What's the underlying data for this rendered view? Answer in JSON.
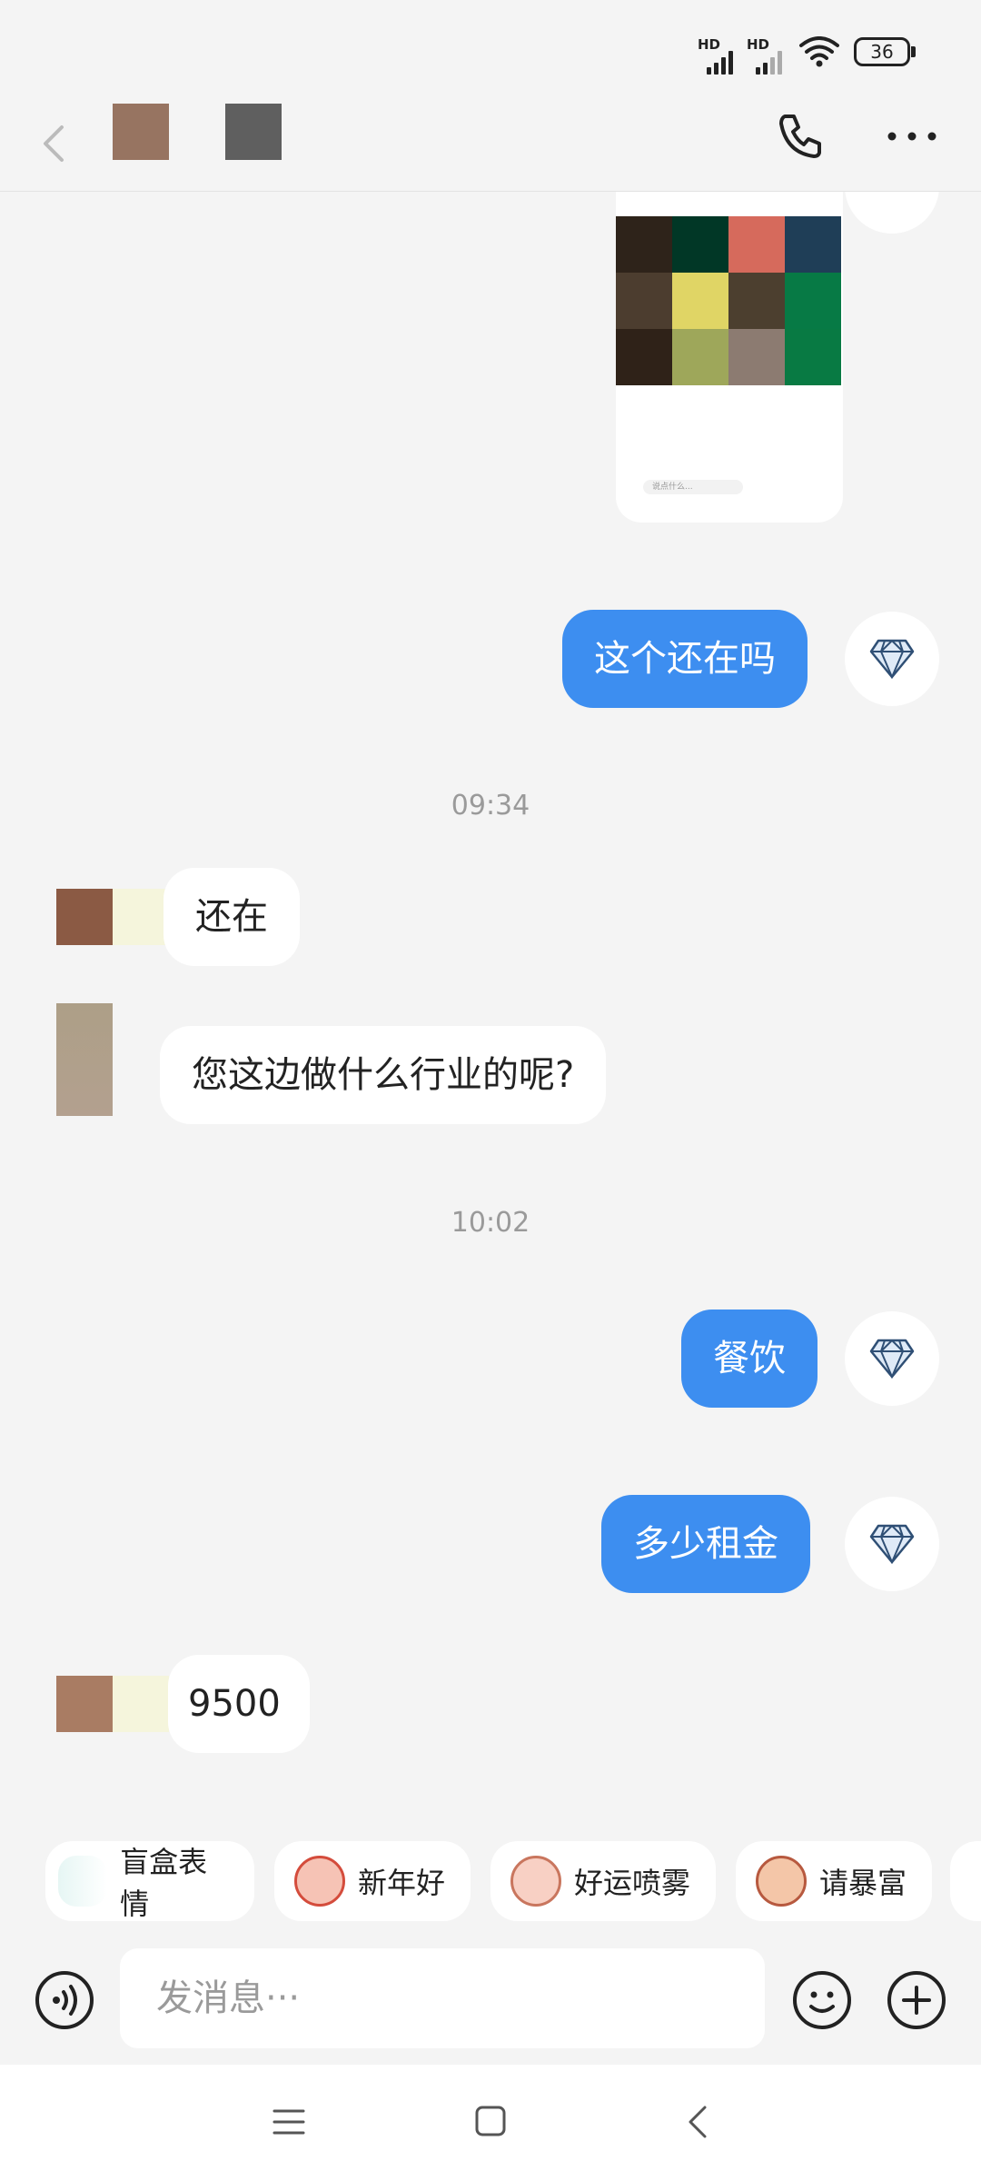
{
  "status_bar": {
    "network_1": "HD",
    "network_2": "HD",
    "battery": "36"
  },
  "header": {
    "back_icon": "chevron-left-icon",
    "phone_icon": "phone-icon",
    "more_icon": "more-horizontal-icon"
  },
  "messages": [
    {
      "type": "image",
      "side": "out"
    },
    {
      "type": "text",
      "side": "out",
      "text": "这个还在吗"
    },
    {
      "type": "timestamp",
      "text": "09:34"
    },
    {
      "type": "text",
      "side": "in",
      "text": "还在"
    },
    {
      "type": "text",
      "side": "in",
      "text": "您这边做什么行业的呢?"
    },
    {
      "type": "timestamp",
      "text": "10:02"
    },
    {
      "type": "text",
      "side": "out",
      "text": "餐饮"
    },
    {
      "type": "text",
      "side": "out",
      "text": "多少租金"
    },
    {
      "type": "text",
      "side": "in",
      "text": "9500"
    }
  ],
  "shared_image": {
    "search_text": "说点什么..."
  },
  "quick_stickers": [
    {
      "label": "盲盒表情"
    },
    {
      "label": "新年好"
    },
    {
      "label": "好运喷雾"
    },
    {
      "label": "请暴富"
    }
  ],
  "composer": {
    "placeholder": "发消息···",
    "voice_icon": "voice-icon",
    "emoji_icon": "emoji-icon",
    "plus_icon": "plus-icon"
  },
  "colors": {
    "accent": "#3d8ef0",
    "background": "#f4f4f4"
  }
}
